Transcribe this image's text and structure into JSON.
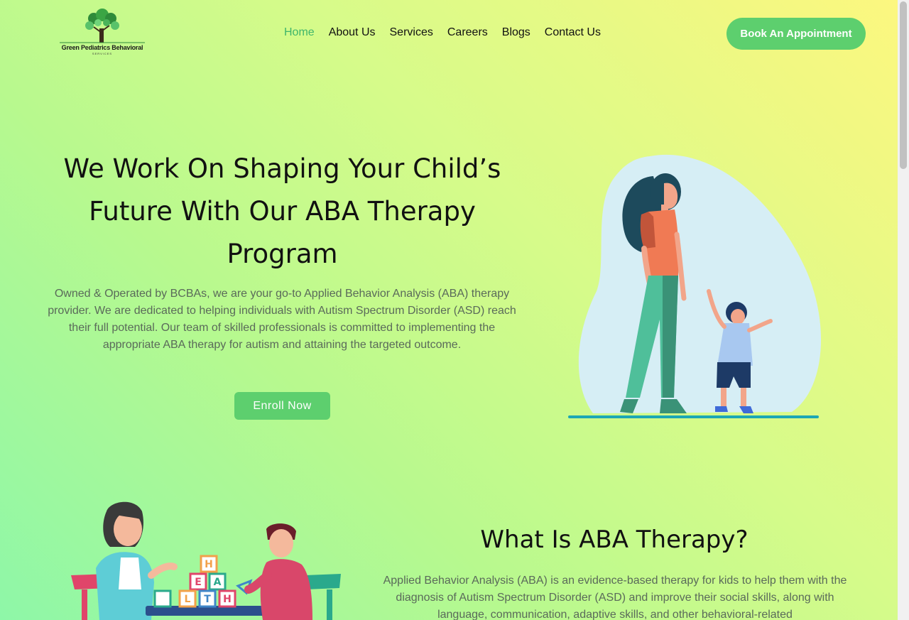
{
  "header": {
    "logo_text": "Green Pediatrics Behavioral",
    "logo_subtext": "SERVICES",
    "nav": [
      {
        "label": "Home",
        "active": true
      },
      {
        "label": "About Us",
        "active": false
      },
      {
        "label": "Services",
        "active": false
      },
      {
        "label": "Careers",
        "active": false
      },
      {
        "label": "Blogs",
        "active": false
      },
      {
        "label": "Contact Us",
        "active": false
      }
    ],
    "cta_label": "Book An Appointment"
  },
  "hero": {
    "title": "We Work On Shaping Your Child’s Future With Our ABA Therapy Program",
    "description": "Owned & Operated by BCBAs, we are your go-to Applied Behavior Analysis (ABA) therapy provider. We are dedicated to helping individuals with Autism Spectrum Disorder (ASD) reach their full potential. Our team of skilled professionals is committed to implementing the appropriate ABA therapy for autism and attaining the targeted outcome.",
    "button_label": "Enroll Now"
  },
  "about": {
    "title": "What Is ABA Therapy?",
    "description": "Applied Behavior Analysis (ABA) is an evidence-based therapy for kids to help them with the diagnosis of Autism Spectrum Disorder (ASD) and improve their social skills, along with language, communication, adaptive skills, and other behavioral-related",
    "blocks": [
      "H",
      "E",
      "A",
      "L",
      "T",
      "H"
    ]
  },
  "colors": {
    "accent": "#5dcf6e",
    "active_nav": "#3fb56b"
  }
}
